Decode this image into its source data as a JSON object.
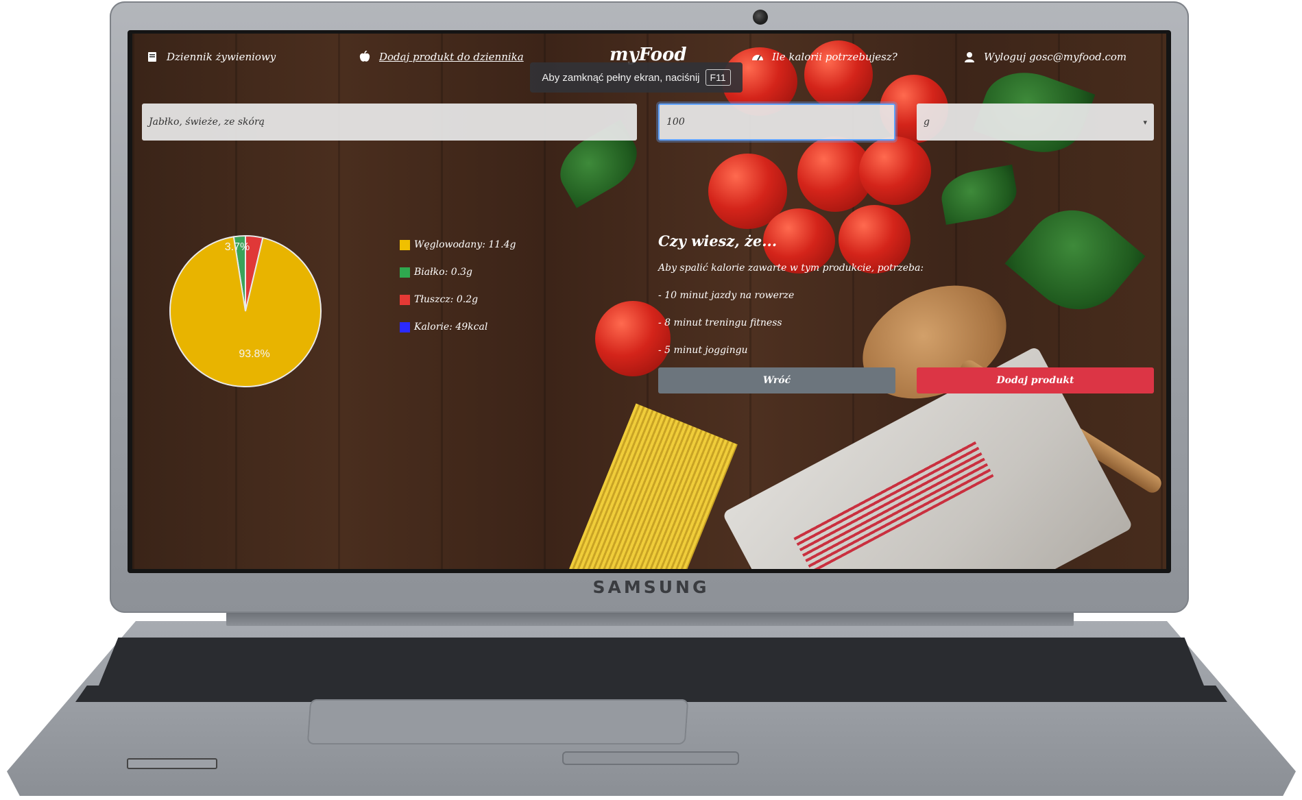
{
  "laptop": {
    "brand": "SAMSUNG"
  },
  "nav": {
    "diary": "Dziennik żywieniowy",
    "add_product": "Dodaj produkt do dziennika",
    "logo": "myFood",
    "calories_needed": "Ile kalorii potrzebujesz?",
    "logout": "Wyloguj gosc@myfood.com"
  },
  "fullscreen_notice": {
    "text": "Aby zamknąć pełny ekran, naciśnij",
    "key": "F11"
  },
  "form": {
    "product": "Jabłko, świeże, ze skórą",
    "amount": "100",
    "unit": "g"
  },
  "chart_data": {
    "type": "pie",
    "slices": [
      {
        "label": "Węglowodany",
        "value": 93.8,
        "color": "#e8b400"
      },
      {
        "label": "Białko",
        "value": 2.5,
        "color": "#3aa35a"
      },
      {
        "label": "Tłuszcz",
        "value": 3.7,
        "color": "#e03838"
      }
    ],
    "data_labels": [
      "93.8%",
      "3.7%"
    ]
  },
  "legend": [
    {
      "text": "Węglowodany: 11.4g",
      "color": "#f0c000"
    },
    {
      "text": "Białko: 0.3g",
      "color": "#2fa84f"
    },
    {
      "text": "Tłuszcz: 0.2g",
      "color": "#e53935"
    },
    {
      "text": "Kalorie: 49kcal",
      "color": "#2a2aff"
    }
  ],
  "fact": {
    "title": "Czy wiesz, że...",
    "intro": "Aby spalić kalorie zawarte w tym produkcie, potrzeba:",
    "items": [
      "- 10 minut jazdy na rowerze",
      "- 8 minut treningu fitness",
      "- 5 minut joggingu"
    ]
  },
  "buttons": {
    "back": "Wróć",
    "add": "Dodaj produkt",
    "back_color": "#6c757d",
    "add_color": "#dc3545"
  }
}
